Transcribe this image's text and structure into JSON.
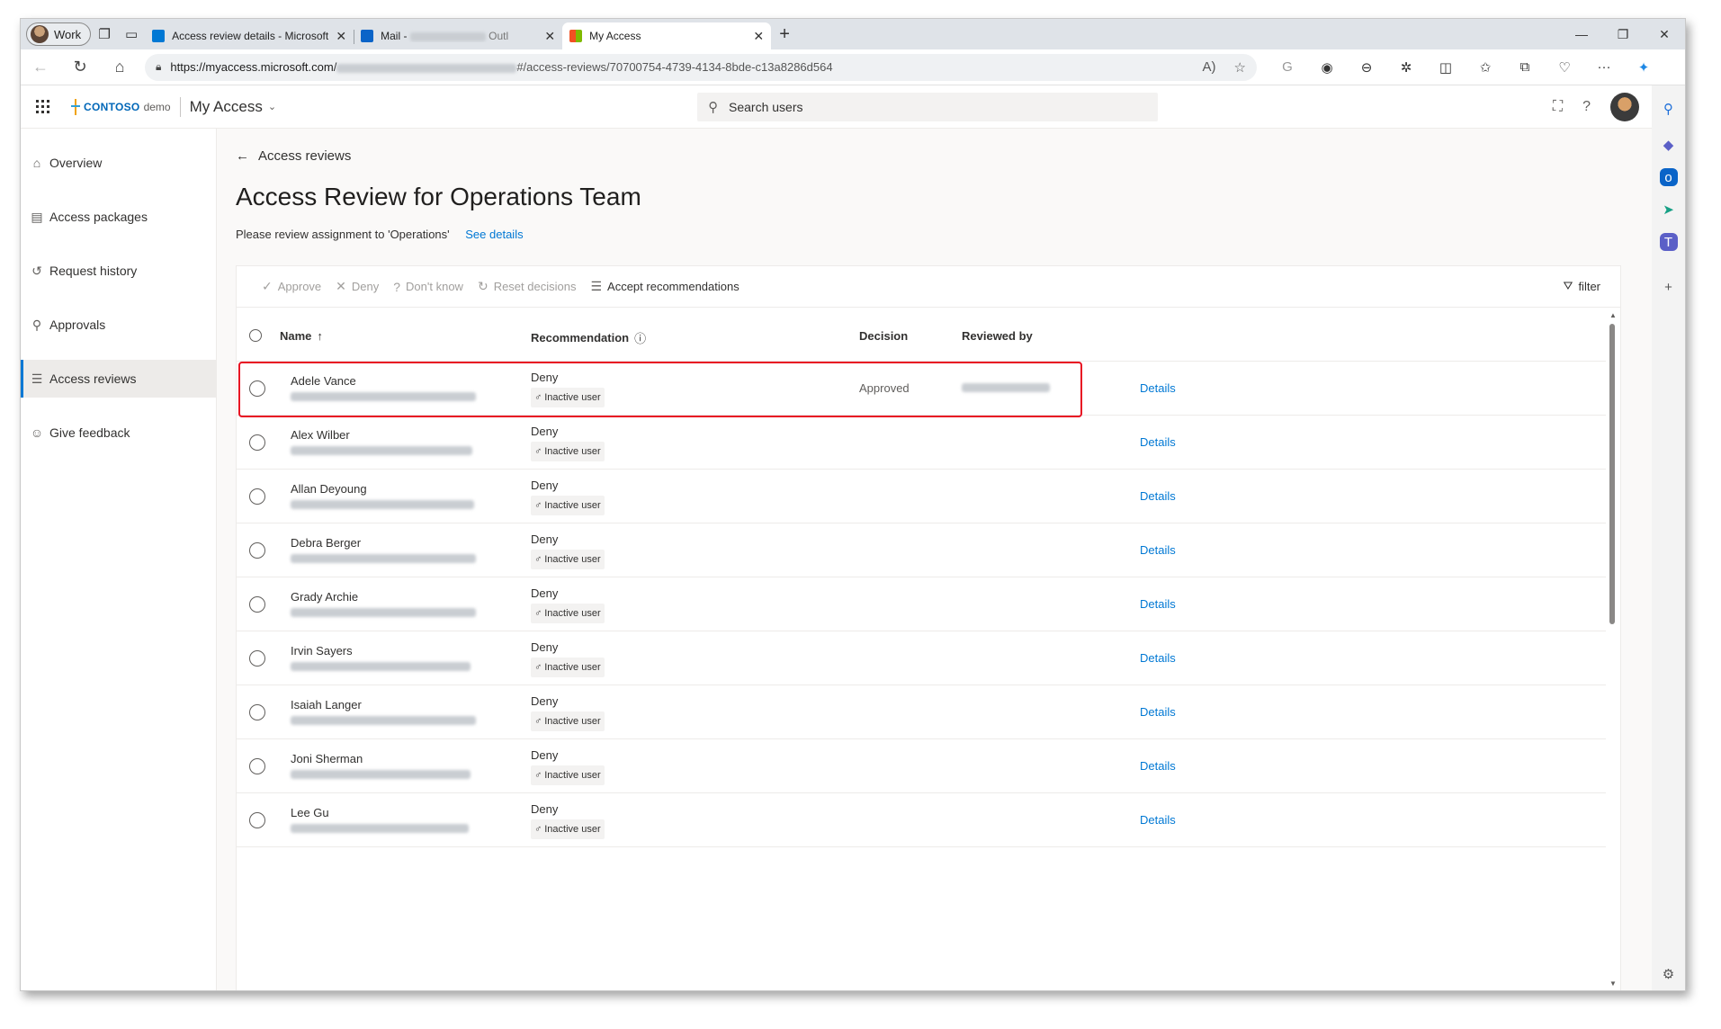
{
  "browser": {
    "profile": "Work",
    "tabs": [
      {
        "title": "Access review details - Microsoft",
        "favicon_color": "#0078d4",
        "active": false
      },
      {
        "title": "Mail -",
        "suffix": "Outl",
        "favicon_color": "#0a64c8",
        "active": false
      },
      {
        "title": "My Access",
        "favicon_color": "#f25022",
        "active": true
      }
    ],
    "url_prefix": "https://myaccess.microsoft.com/",
    "url_suffix": "#/access-reviews/70700754-4739-4134-8bde-c13a8286d564"
  },
  "header": {
    "brand": "CONTOSO",
    "brand_suffix": "demo",
    "app_title": "My Access",
    "search_placeholder": "Search users"
  },
  "sidebar": {
    "items": [
      {
        "label": "Overview",
        "icon": "home-icon",
        "glyph": "⌂",
        "selected": false
      },
      {
        "label": "Access packages",
        "icon": "package-icon",
        "glyph": "▤",
        "selected": false
      },
      {
        "label": "Request history",
        "icon": "history-icon",
        "glyph": "↺",
        "selected": false
      },
      {
        "label": "Approvals",
        "icon": "person-icon",
        "glyph": "⚲",
        "selected": false
      },
      {
        "label": "Access reviews",
        "icon": "checklist-icon",
        "glyph": "☰",
        "selected": true
      },
      {
        "label": "Give feedback",
        "icon": "feedback-icon",
        "glyph": "☺",
        "selected": false
      }
    ]
  },
  "main": {
    "back_label": "Access reviews",
    "title": "Access Review for Operations Team",
    "subtitle": "Please review assignment to 'Operations'",
    "see_details": "See details"
  },
  "toolbar": {
    "approve": "Approve",
    "deny": "Deny",
    "dont_know": "Don't know",
    "reset": "Reset decisions",
    "accept": "Accept recommendations",
    "filter": "filter"
  },
  "table": {
    "columns": {
      "name": "Name",
      "recommendation": "Recommendation",
      "decision": "Decision",
      "reviewed_by": "Reviewed by"
    },
    "rows": [
      {
        "name": "Adele Vance",
        "recommendation": "Deny",
        "tag": "Inactive user",
        "decision": "Approved",
        "details": "Details"
      },
      {
        "name": "Alex Wilber",
        "recommendation": "Deny",
        "tag": "Inactive user",
        "decision": "",
        "details": "Details"
      },
      {
        "name": "Allan Deyoung",
        "recommendation": "Deny",
        "tag": "Inactive user",
        "decision": "",
        "details": "Details"
      },
      {
        "name": "Debra Berger",
        "recommendation": "Deny",
        "tag": "Inactive user",
        "decision": "",
        "details": "Details"
      },
      {
        "name": "Grady Archie",
        "recommendation": "Deny",
        "tag": "Inactive user",
        "decision": "",
        "details": "Details"
      },
      {
        "name": "Irvin Sayers",
        "recommendation": "Deny",
        "tag": "Inactive user",
        "decision": "",
        "details": "Details"
      },
      {
        "name": "Isaiah Langer",
        "recommendation": "Deny",
        "tag": "Inactive user",
        "decision": "",
        "details": "Details"
      },
      {
        "name": "Joni Sherman",
        "recommendation": "Deny",
        "tag": "Inactive user",
        "decision": "",
        "details": "Details"
      },
      {
        "name": "Lee Gu",
        "recommendation": "Deny",
        "tag": "Inactive user",
        "decision": "",
        "details": "Details"
      }
    ]
  },
  "colors": {
    "accent": "#0078d4",
    "highlight": "#e81123"
  }
}
